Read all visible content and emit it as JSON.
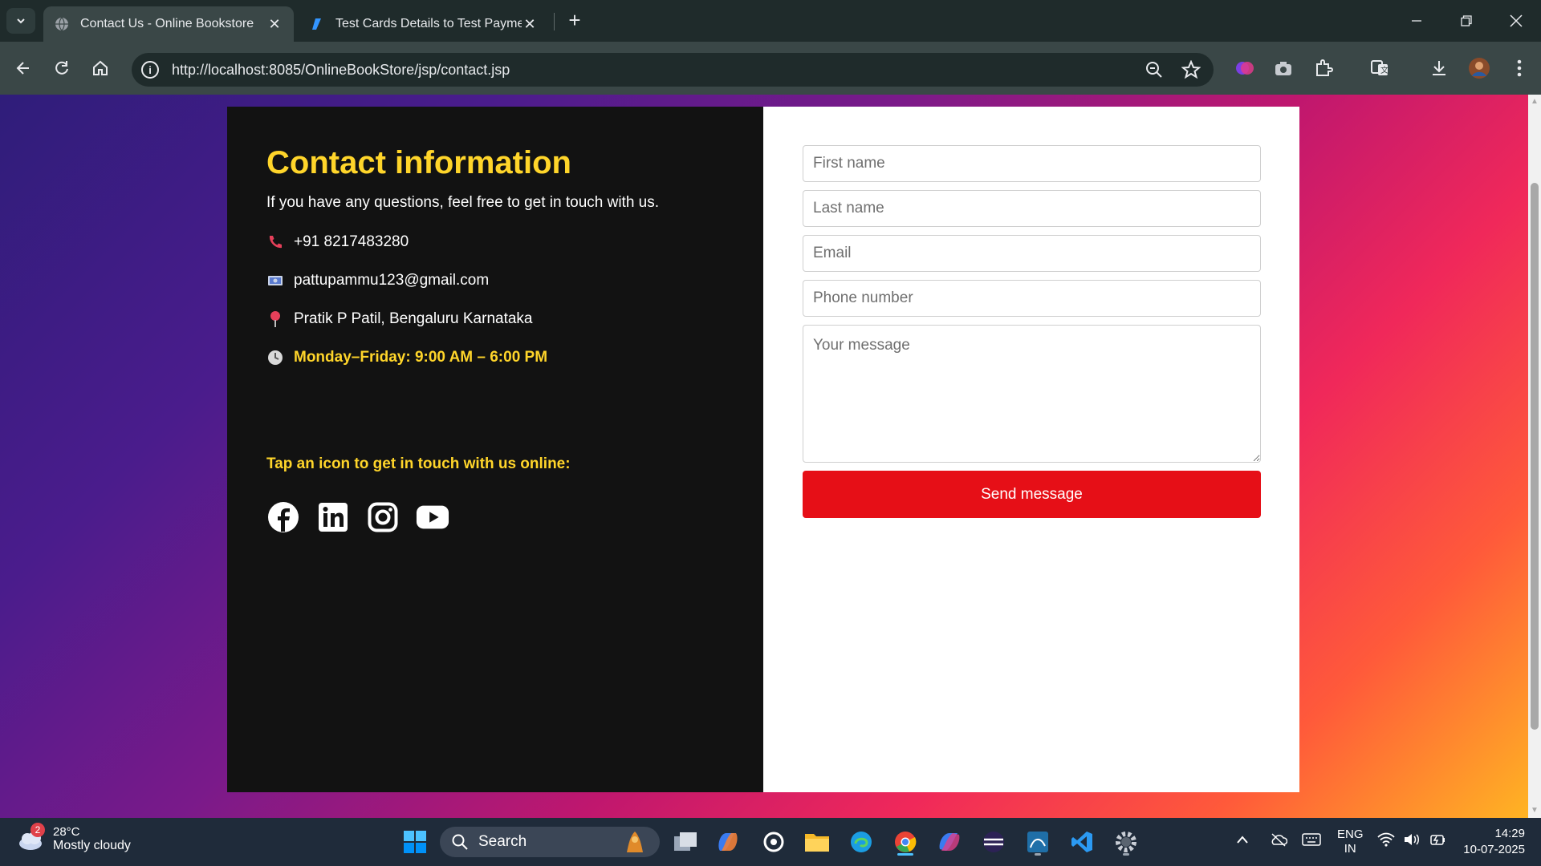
{
  "browser": {
    "tabs": [
      {
        "title": "Contact Us - Online Bookstore",
        "active": true
      },
      {
        "title": "Test Cards Details to Test Payment",
        "active": false
      }
    ],
    "url": "http://localhost:8085/OnlineBookStore/jsp/contact.jsp"
  },
  "contact": {
    "heading": "Contact information",
    "lead": "If you have any questions, feel free to get in touch with us.",
    "phone": "+91 8217483280",
    "email": "pattupammu123@gmail.com",
    "address": "Pratik P Patil, Bengaluru Karnataka",
    "hours": "Monday–Friday: 9:00 AM – 6:00 PM",
    "social_heading": "Tap an icon to get in touch with us online:"
  },
  "form": {
    "first_name_placeholder": "First name",
    "last_name_placeholder": "Last name",
    "email_placeholder": "Email",
    "phone_placeholder": "Phone number",
    "message_placeholder": "Your message",
    "send_label": "Send message"
  },
  "taskbar": {
    "weather_temp": "28°C",
    "weather_desc": "Mostly cloudy",
    "weather_badge": "2",
    "search_label": "Search",
    "lang_line1": "ENG",
    "lang_line2": "IN",
    "time": "14:29",
    "date": "10-07-2025"
  },
  "colors": {
    "accent_yellow": "#ffd52a",
    "send_button": "#e60f17",
    "info_panel_bg": "#121212"
  }
}
